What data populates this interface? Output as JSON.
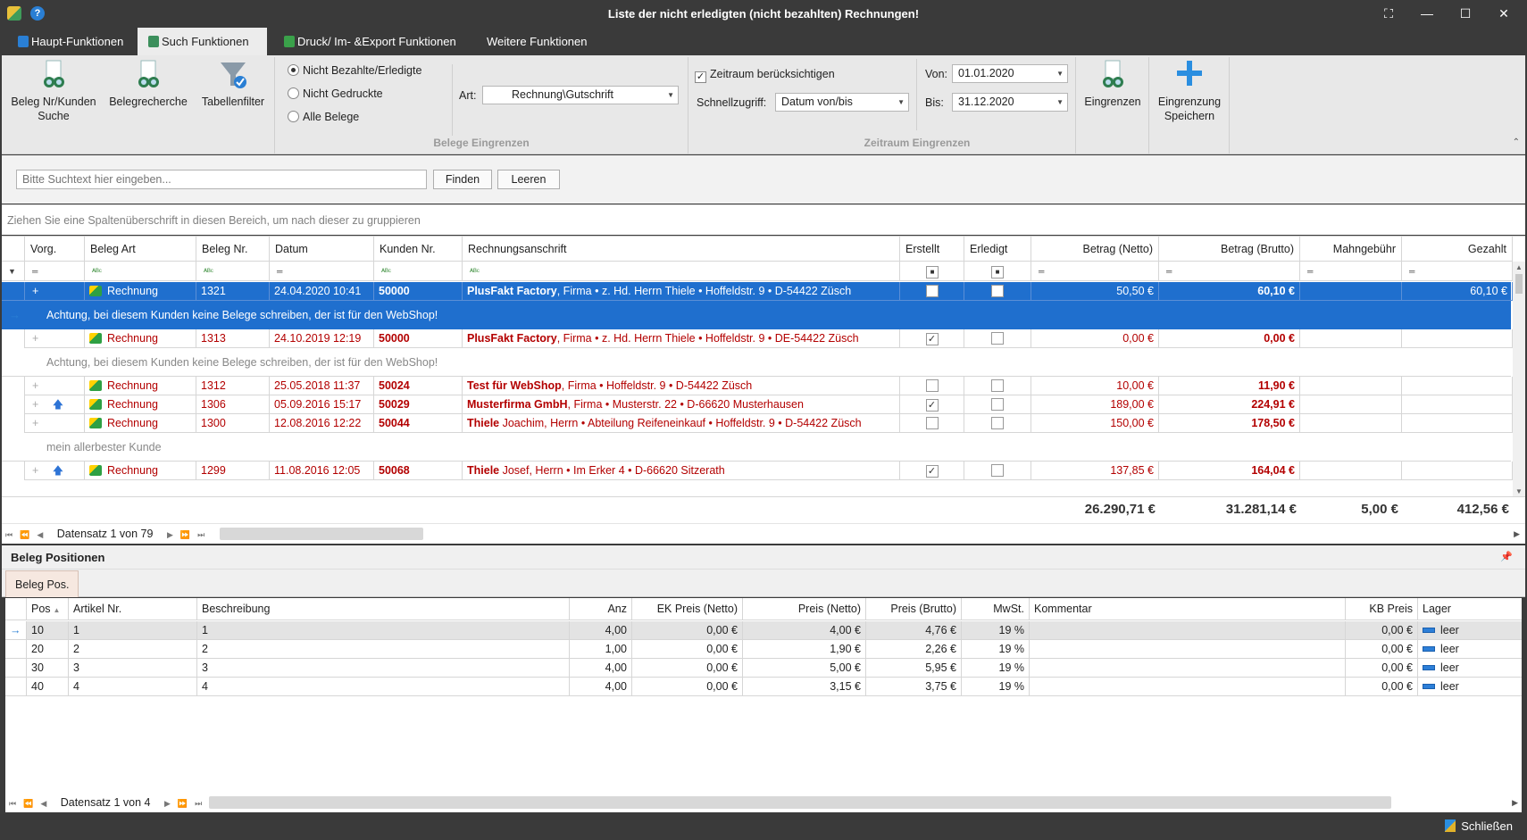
{
  "window": {
    "title": "Liste der nicht erledigten (nicht bezahlten) Rechnungen!"
  },
  "tabs": [
    {
      "label": "Haupt-Funktionen"
    },
    {
      "label": "Such Funktionen"
    },
    {
      "label": "Druck/ Im- &Export Funktionen"
    },
    {
      "label": "Weitere Funktionen"
    }
  ],
  "ribbon": {
    "btn_belegnr": "Beleg Nr/Kunden\nSuche",
    "btn_belegnr_l1": "Beleg Nr/Kunden",
    "btn_belegnr_l2": "Suche",
    "btn_belegrecherche": "Belegrecherche",
    "btn_tabellenfilter": "Tabellenfilter",
    "radio1": "Nicht Bezahlte/Erledigte",
    "radio2": "Nicht Gedruckte",
    "radio3": "Alle Belege",
    "art_label": "Art:",
    "art_value": "Rechnung\\Gutschrift",
    "group1_label": "Belege Eingrenzen",
    "zeitraum_chk": "Zeitraum berücksichtigen",
    "schnell_label": "Schnellzugriff:",
    "schnell_value": "Datum von/bis",
    "von_label": "Von:",
    "von_value": "01.01.2020",
    "bis_label": "Bis:",
    "bis_value": "31.12.2020",
    "btn_eingrenzen": "Eingrenzen",
    "btn_speichern_l1": "Eingrenzung",
    "btn_speichern_l2": "Speichern",
    "group2_label": "Zeitraum Eingrenzen"
  },
  "search": {
    "placeholder": "Bitte Suchtext hier eingeben...",
    "find": "Finden",
    "clear": "Leeren"
  },
  "group_panel": "Ziehen Sie eine Spaltenüberschrift in diesen Bereich, um nach dieser zu gruppieren",
  "grid": {
    "columns": [
      "Vorg.",
      "Beleg Art",
      "Beleg Nr.",
      "Datum",
      "Kunden Nr.",
      "Rechnungsanschrift",
      "Erstellt",
      "Erledigt",
      "Betrag (Netto)",
      "Betrag (Brutto)",
      "Mahngebühr",
      "Gezahlt"
    ],
    "rows": [
      {
        "art": "Rechnung",
        "nr": "1321",
        "datum": "24.04.2020 10:41",
        "kunde": "50000",
        "name": "PlusFakt Factory",
        "addr": ", Firma • z. Hd. Herrn Thiele • Hoffeldstr. 9 • D-54422 Züsch",
        "netto": "50,50 €",
        "brutto": "60,10 €",
        "gezahlt": "60,10 €",
        "note": "Achtung, bei diesem Kunden keine Belege schreiben, der ist für den WebShop!"
      },
      {
        "art": "Rechnung",
        "nr": "1313",
        "datum": "24.10.2019 12:19",
        "kunde": "50000",
        "name": "PlusFakt Factory",
        "addr": ", Firma • z. Hd. Herrn Thiele • Hoffeldstr. 9 • DE-54422 Züsch",
        "netto": "0,00 €",
        "brutto": "0,00 €",
        "gezahlt": "",
        "note": "Achtung, bei diesem Kunden keine Belege schreiben, der ist für den WebShop!"
      },
      {
        "art": "Rechnung",
        "nr": "1312",
        "datum": "25.05.2018 11:37",
        "kunde": "50024",
        "name": "Test für WebShop",
        "addr": ", Firma • Hoffeldstr. 9 • D-54422 Züsch",
        "netto": "10,00 €",
        "brutto": "11,90 €",
        "gezahlt": ""
      },
      {
        "art": "Rechnung",
        "nr": "1306",
        "datum": "05.09.2016 15:17",
        "kunde": "50029",
        "name": "Musterfirma GmbH",
        "addr": ", Firma • Musterstr. 22 • D-66620 Musterhausen",
        "netto": "189,00 €",
        "brutto": "224,91 €",
        "gezahlt": ""
      },
      {
        "art": "Rechnung",
        "nr": "1300",
        "datum": "12.08.2016 12:22",
        "kunde": "50044",
        "name": "Thiele",
        "addr": " Joachim, Herrn • Abteilung Reifeneinkauf • Hoffeldstr. 9 • D-54422 Züsch",
        "netto": "150,00 €",
        "brutto": "178,50 €",
        "gezahlt": "",
        "note": "mein allerbester Kunde"
      },
      {
        "art": "Rechnung",
        "nr": "1299",
        "datum": "11.08.2016 12:05",
        "kunde": "50068",
        "name": "Thiele",
        "addr": " Josef, Herrn • Im Erker 4 • D-66620 Sitzerath",
        "netto": "137,85 €",
        "brutto": "164,04 €",
        "gezahlt": ""
      }
    ],
    "totals": {
      "netto": "26.290,71 €",
      "brutto": "31.281,14 €",
      "mahn": "5,00 €",
      "gezahlt": "412,56 €"
    },
    "nav": "Datensatz 1 von 79"
  },
  "positions": {
    "title": "Beleg Positionen",
    "tab": "Beleg Pos.",
    "columns": [
      "Pos",
      "Artikel Nr.",
      "Beschreibung",
      "Anz",
      "EK Preis (Netto)",
      "Preis (Netto)",
      "Preis (Brutto)",
      "MwSt.",
      "Kommentar",
      "KB Preis",
      "Lager"
    ],
    "rows": [
      {
        "pos": "10",
        "art": "1",
        "desc": "1",
        "anz": "4,00",
        "ek": "0,00 €",
        "netto": "4,00 €",
        "brutto": "4,76 €",
        "mwst": "19 %",
        "kb": "0,00 €",
        "lager": "leer"
      },
      {
        "pos": "20",
        "art": "2",
        "desc": "2",
        "anz": "1,00",
        "ek": "0,00 €",
        "netto": "1,90 €",
        "brutto": "2,26 €",
        "mwst": "19 %",
        "kb": "0,00 €",
        "lager": "leer"
      },
      {
        "pos": "30",
        "art": "3",
        "desc": "3",
        "anz": "4,00",
        "ek": "0,00 €",
        "netto": "5,00 €",
        "brutto": "5,95 €",
        "mwst": "19 %",
        "kb": "0,00 €",
        "lager": "leer"
      },
      {
        "pos": "40",
        "art": "4",
        "desc": "4",
        "anz": "4,00",
        "ek": "0,00 €",
        "netto": "3,15 €",
        "brutto": "3,75 €",
        "mwst": "19 %",
        "kb": "0,00 €",
        "lager": "leer"
      }
    ],
    "nav": "Datensatz 1 von 4"
  },
  "status": {
    "close": "Schließen"
  },
  "colors": {
    "selection": "#1f6fce",
    "accent_text": "#b30000",
    "dark_chrome": "#3a3a3a"
  }
}
